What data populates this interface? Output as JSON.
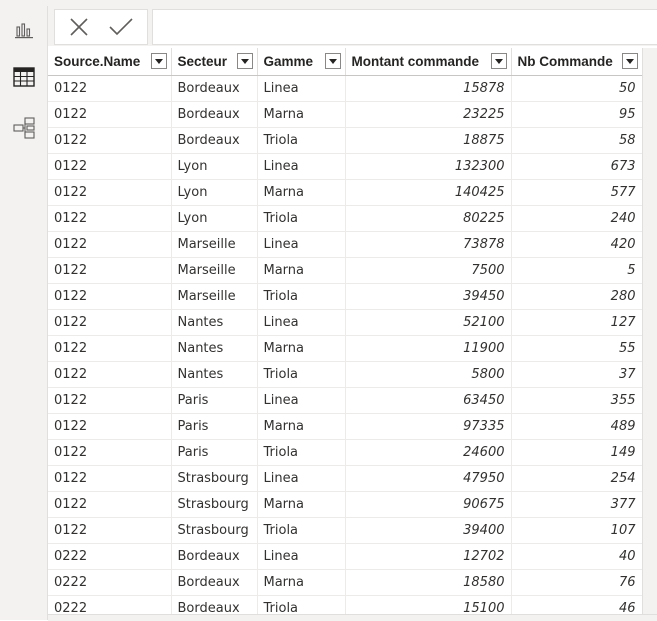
{
  "toolbar": {
    "cancel_icon": "close-icon",
    "commit_icon": "checkmark-icon",
    "formula_value": ""
  },
  "sidebar": {
    "items": [
      {
        "name": "report-view",
        "icon": "bar-chart-icon"
      },
      {
        "name": "data-view",
        "icon": "table-grid-icon",
        "active": true
      },
      {
        "name": "model-view",
        "icon": "model-diagram-icon"
      }
    ]
  },
  "table": {
    "columns": [
      "Source.Name",
      "Secteur",
      "Gamme",
      "Montant commande",
      "Nb Commande"
    ],
    "rows": [
      [
        "0122",
        "Bordeaux",
        "Linea",
        "15878",
        "50"
      ],
      [
        "0122",
        "Bordeaux",
        "Marna",
        "23225",
        "95"
      ],
      [
        "0122",
        "Bordeaux",
        "Triola",
        "18875",
        "58"
      ],
      [
        "0122",
        "Lyon",
        "Linea",
        "132300",
        "673"
      ],
      [
        "0122",
        "Lyon",
        "Marna",
        "140425",
        "577"
      ],
      [
        "0122",
        "Lyon",
        "Triola",
        "80225",
        "240"
      ],
      [
        "0122",
        "Marseille",
        "Linea",
        "73878",
        "420"
      ],
      [
        "0122",
        "Marseille",
        "Marna",
        "7500",
        "5"
      ],
      [
        "0122",
        "Marseille",
        "Triola",
        "39450",
        "280"
      ],
      [
        "0122",
        "Nantes",
        "Linea",
        "52100",
        "127"
      ],
      [
        "0122",
        "Nantes",
        "Marna",
        "11900",
        "55"
      ],
      [
        "0122",
        "Nantes",
        "Triola",
        "5800",
        "37"
      ],
      [
        "0122",
        "Paris",
        "Linea",
        "63450",
        "355"
      ],
      [
        "0122",
        "Paris",
        "Marna",
        "97335",
        "489"
      ],
      [
        "0122",
        "Paris",
        "Triola",
        "24600",
        "149"
      ],
      [
        "0122",
        "Strasbourg",
        "Linea",
        "47950",
        "254"
      ],
      [
        "0122",
        "Strasbourg",
        "Marna",
        "90675",
        "377"
      ],
      [
        "0122",
        "Strasbourg",
        "Triola",
        "39400",
        "107"
      ],
      [
        "0222",
        "Bordeaux",
        "Linea",
        "12702",
        "40"
      ],
      [
        "0222",
        "Bordeaux",
        "Marna",
        "18580",
        "76"
      ],
      [
        "0222",
        "Bordeaux",
        "Triola",
        "15100",
        "46"
      ]
    ]
  },
  "colors": {
    "chrome": "#f3f2f1",
    "border": "#e1dfdd",
    "icon": "#605e5c"
  }
}
